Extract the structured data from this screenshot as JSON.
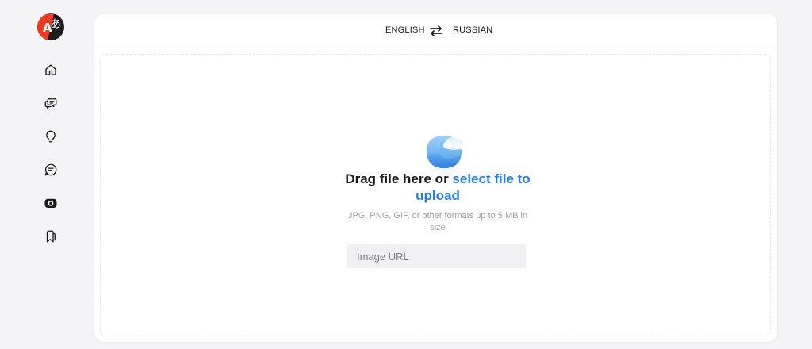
{
  "app": {
    "logo_icon": "translator-logo-icon",
    "brand_colors": {
      "red": "#ee3a23",
      "dark": "#1c1c1c",
      "link": "#2a7de1"
    }
  },
  "sidebar": {
    "items": [
      {
        "name": "home",
        "icon": "home-icon"
      },
      {
        "name": "dialogue",
        "icon": "chat-bubbles-icon"
      },
      {
        "name": "ideas",
        "icon": "lightbulb-icon"
      },
      {
        "name": "documents",
        "icon": "text-bubble-icon"
      },
      {
        "name": "images",
        "icon": "camera-icon",
        "active": true
      },
      {
        "name": "saved",
        "icon": "bookmarks-icon"
      }
    ]
  },
  "language_bar": {
    "source_language": "ENGLISH",
    "target_language": "RUSSIAN",
    "swap_icon": "swap-arrows-icon"
  },
  "upload": {
    "icon": "image-upload-icon",
    "headline_prefix": "Drag file here or ",
    "headline_link": "select file to upload",
    "hint": "JPG, PNG, GIF, or other formats up to 5 MB in size",
    "url_placeholder": "Image URL",
    "url_value": ""
  }
}
